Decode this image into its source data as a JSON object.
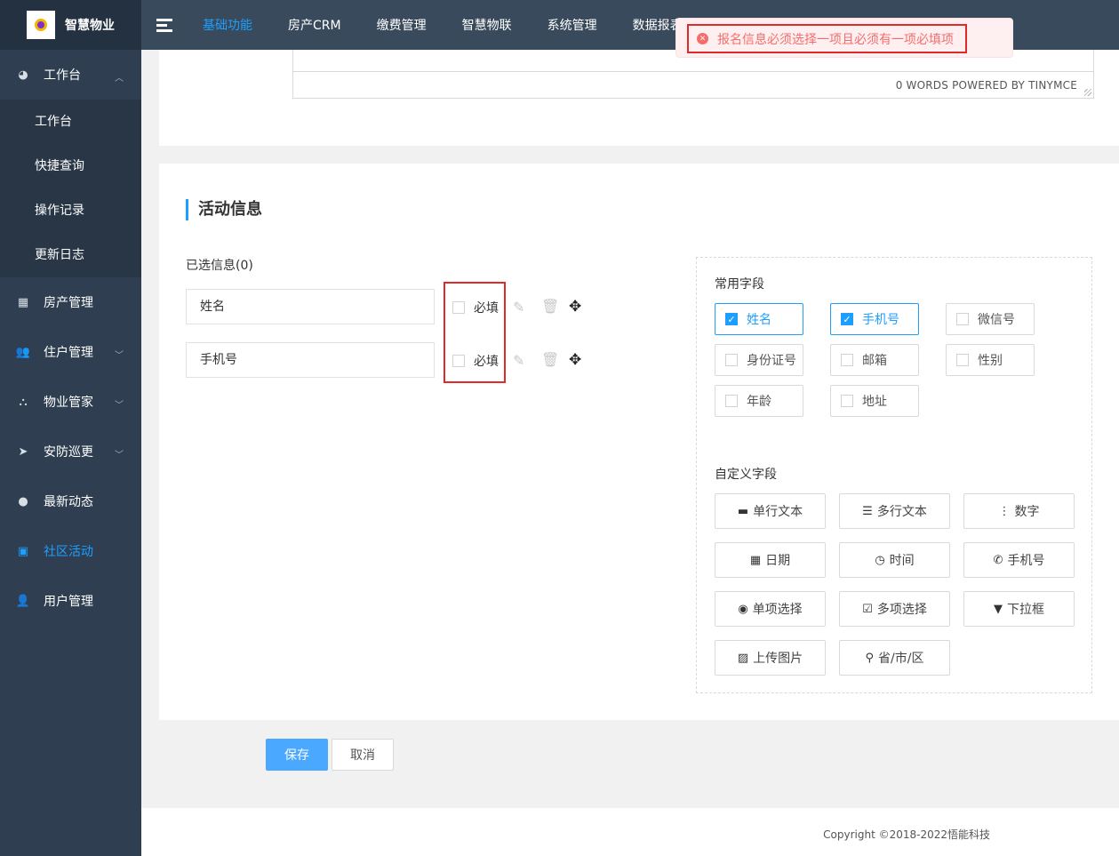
{
  "brand": {
    "name": "智慧物业"
  },
  "sidebar": {
    "items": [
      {
        "label": "工作台",
        "icon": "dashboard-icon"
      },
      {
        "label": "房产管理",
        "icon": "table-icon"
      },
      {
        "label": "住户管理",
        "icon": "users-icon"
      },
      {
        "label": "物业管家",
        "icon": "sitemap-icon"
      },
      {
        "label": "安防巡更",
        "icon": "paper-plane-icon"
      },
      {
        "label": "最新动态",
        "icon": "chat-icon"
      },
      {
        "label": "社区活动",
        "icon": "gift-icon"
      },
      {
        "label": "用户管理",
        "icon": "user-icon"
      }
    ],
    "submenu": [
      "工作台",
      "快捷查询",
      "操作记录",
      "更新日志"
    ],
    "active_color": "#1e9fff"
  },
  "topnav": {
    "items": [
      "基础功能",
      "房产CRM",
      "缴费管理",
      "智慧物联",
      "系统管理",
      "数据报表"
    ]
  },
  "editor": {
    "status_text": "0 WORDS POWERED BY TINYMCE"
  },
  "section": {
    "title": "活动信息"
  },
  "selected": {
    "label": "已选信息(0)",
    "fields": [
      {
        "name": "姓名",
        "required_label": "必填",
        "required": false
      },
      {
        "name": "手机号",
        "required_label": "必填",
        "required": false
      }
    ]
  },
  "common_fields": {
    "title": "常用字段",
    "items": [
      {
        "label": "姓名",
        "checked": true
      },
      {
        "label": "手机号",
        "checked": true
      },
      {
        "label": "微信号",
        "checked": false
      },
      {
        "label": "身份证号",
        "checked": false
      },
      {
        "label": "邮箱",
        "checked": false
      },
      {
        "label": "性别",
        "checked": false
      },
      {
        "label": "年龄",
        "checked": false
      },
      {
        "label": "地址",
        "checked": false
      }
    ]
  },
  "custom_fields": {
    "title": "自定义字段",
    "items": [
      {
        "label": "单行文本",
        "icon": "minus-icon"
      },
      {
        "label": "多行文本",
        "icon": "bars-icon"
      },
      {
        "label": "数字",
        "icon": "ellipsis-vertical-icon"
      },
      {
        "label": "日期",
        "icon": "calendar-icon"
      },
      {
        "label": "时间",
        "icon": "clock-icon"
      },
      {
        "label": "手机号",
        "icon": "phone-icon"
      },
      {
        "label": "单项选择",
        "icon": "radio-icon"
      },
      {
        "label": "多项选择",
        "icon": "checkbox-icon"
      },
      {
        "label": "下拉框",
        "icon": "dropdown-icon"
      },
      {
        "label": "上传图片",
        "icon": "image-icon"
      },
      {
        "label": "省/市/区",
        "icon": "map-marker-icon"
      }
    ]
  },
  "buttons": {
    "save": "保存",
    "cancel": "取消"
  },
  "footer": {
    "copyright": "Copyright ©2018-2022悟能科技"
  },
  "toast": {
    "message": "报名信息必须选择一项且必须有一项必填项",
    "icon": "error-circle-icon",
    "color": "#f56c6c"
  }
}
